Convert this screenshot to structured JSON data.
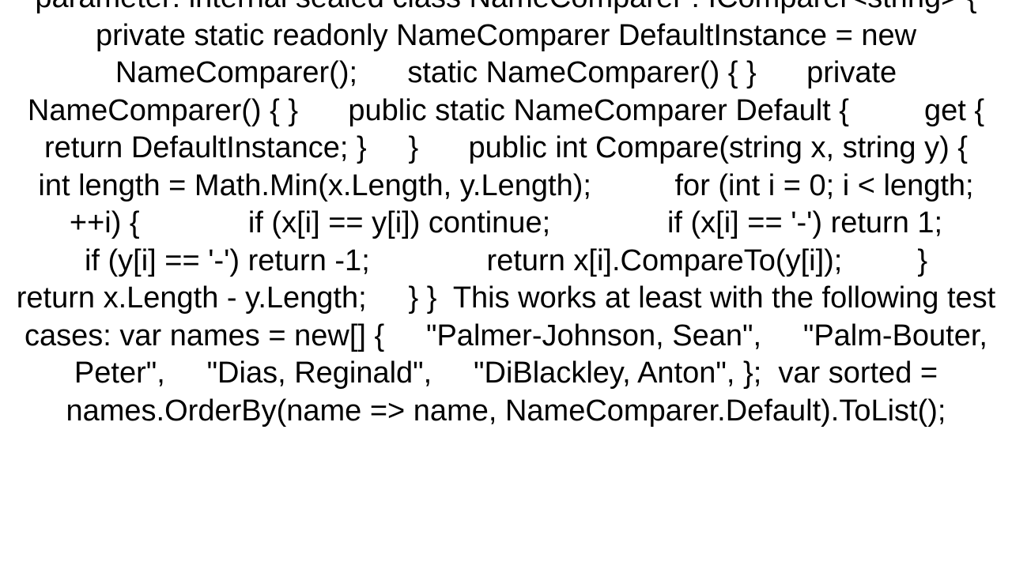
{
  "main": {
    "text": "parameter: internal sealed class NameComparer : IComparer<string> {     private static readonly NameComparer DefaultInstance = new NameComparer();      static NameComparer() { }      private NameComparer() { }      public static NameComparer Default {         get { return DefaultInstance; }     }      public int Compare(string x, string y) {         int length = Math.Min(x.Length, y.Length);          for (int i = 0; i < length; ++i) {             if (x[i] == y[i]) continue;              if (x[i] == '-') return 1;              if (y[i] == '-') return -1;              return x[i].CompareTo(y[i]);         }          return x.Length - y.Length;     } }  This works at least with the following test cases: var names = new[] {     \"Palmer-Johnson, Sean\",     \"Palm-Bouter, Peter\",     \"Dias, Reginald\",     \"DiBlackley, Anton\", };  var sorted = names.OrderBy(name => name, NameComparer.Default).ToList();"
  }
}
